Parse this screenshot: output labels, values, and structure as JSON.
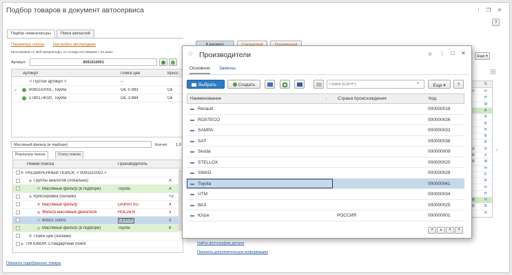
{
  "window": {
    "title": "Подбор товаров в документ автосервиса",
    "controls": [
      "⋮",
      "❐",
      "✕"
    ]
  },
  "tabs": [
    "Подбор номенклатуры",
    "Поиск запчастей"
  ],
  "links": {
    "search_params": "Параметры поиска",
    "autoselect_setup": "Настройка автопродажи",
    "info_line": "Кроссировка:+2, Веб-проценка:ДА, Со склада поставщика:+ на заказ",
    "show_selected": "Показать подобранные товары",
    "find_photos": "Найти фотографии детали",
    "show_more_info": "Показать дополнительную информацию"
  },
  "article": {
    "label": "Артикул:",
    "value": "9091510001"
  },
  "articles_grid": {
    "headers": [
      "Артикул",
      "Поиск цен",
      "Кросс."
    ],
    "rows": [
      {
        "mark": "",
        "name": "< Пустой артикул >",
        "price": "--",
        "cross": ""
      },
      {
        "mark": "✓",
        "name": "9091510001, Toyota",
        "price": "Ок, 5 983",
        "cross": "Ок"
      },
      {
        "mark": "",
        "name": "1780174020, Toyota",
        "price": "Ок, 3 884",
        "cross": "Ок"
      }
    ]
  },
  "filter": {
    "value": "Масляный фильтр (в подборе)",
    "qty_label": "Кол-во:",
    "qty_value": "1,0"
  },
  "result_tabs": [
    "Результаты поиска",
    "Статус поиска"
  ],
  "results_grid": {
    "headers": [
      "Режим поиска",
      "Производитель"
    ],
    "rows": [
      {
        "cb": "",
        "text": "РАСШИРЕННЫЙ ПОИСК: < 9091510001 >",
        "maker": "",
        "n": "",
        "style": "",
        "indent": 8
      },
      {
        "cb": "",
        "text": "Группы аналогов (локально)",
        "maker": "",
        "n": "A",
        "style": "",
        "indent": 20
      },
      {
        "cb": "✓",
        "text": "Масляный фильтр (в подборе)",
        "maker": "Toyota",
        "n": "A",
        "style": "green",
        "indent": 32
      },
      {
        "cb": "",
        "text": "Кроссировка (онлайн)",
        "maker": "",
        "n": "+2",
        "style": "",
        "indent": 20
      },
      {
        "cb": "",
        "text": "Масляный фильтр",
        "maker": "DAIHATSU",
        "n": "4",
        "style": "red",
        "indent": 32
      },
      {
        "cb": "",
        "text": "Фильтр масляный двигателя",
        "maker": "HOLDEN",
        "n": "3",
        "style": "red",
        "indent": 32
      },
      {
        "cb": "",
        "text": "90915 10001",
        "maker": "LEXUS",
        "n": "3",
        "style": "sel",
        "indent": 32
      },
      {
        "cb": "✓",
        "text": "Масляный фильтр (в подборе)",
        "maker": "Toyota",
        "n": "8",
        "style": "green",
        "indent": 32
      },
      {
        "cb": "",
        "text": "Поиск цен (онлайн)",
        "maker": "",
        "n": "",
        "style": "",
        "indent": 20
      },
      {
        "cb": "",
        "text": "ТИПОВОЙ: Стандартный поиск",
        "maker": "",
        "n": "",
        "style": "",
        "indent": 8
      }
    ]
  },
  "background_buttons": [
    "В документ",
    "Стандартный",
    "Расширенный"
  ],
  "right_panel": {
    "more": "Еще",
    "help": "?",
    "col_header": "С",
    "values": [
      "07",
      "",
      "",
      "",
      "",
      "",
      "",
      "",
      "",
      "49",
      "98",
      "38",
      "",
      "",
      "",
      "",
      "",
      "38",
      "38",
      "",
      ""
    ],
    "letters": [
      "Н",
      "Н",
      "М",
      "А",
      "А",
      "В",
      "Н",
      "В",
      "В",
      "Н",
      "Х",
      "М",
      "Н",
      "Р",
      "В",
      "Н",
      "Н",
      "Н",
      "В",
      "Н"
    ]
  },
  "dialog": {
    "title": "Производители",
    "tabs": [
      "Основное",
      "Замены"
    ],
    "toolbar": {
      "select": "Выбрать",
      "create": "Создать",
      "search_placeholder": "Поиск (Ctrl+F)",
      "more": "Еще",
      "help": "?"
    },
    "headers": {
      "name": "Наименование",
      "country": "Страна происхождения",
      "code": "Код"
    },
    "rows": [
      {
        "name": "Renault",
        "country": "",
        "code": "000000018"
      },
      {
        "name": "ROSTECO",
        "country": "",
        "code": "000000026"
      },
      {
        "name": "SAMPA",
        "country": "",
        "code": "000000032"
      },
      {
        "name": "SAT",
        "country": "",
        "code": "000000038"
      },
      {
        "name": "Skoda",
        "country": "",
        "code": "000000009"
      },
      {
        "name": "STELLOX",
        "country": "",
        "code": "000000020"
      },
      {
        "name": "SWAG",
        "country": "",
        "code": "000000028"
      },
      {
        "name": "Toyota",
        "country": "",
        "code": "000000041"
      },
      {
        "name": "UTM",
        "country": "",
        "code": "000000034"
      },
      {
        "name": "ВАЗ",
        "country": "",
        "code": "000000025"
      },
      {
        "name": "Югра",
        "country": "РОССИЯ",
        "code": "000000001"
      }
    ],
    "selected_index": 7
  },
  "colors": {
    "accent": "#4a90d9",
    "select_button": "#2f7cc4",
    "link_orange": "#c96a12",
    "link_blue": "#2157a5",
    "row_green": "#ddf2cf",
    "row_selected": "#c6d9ec"
  }
}
